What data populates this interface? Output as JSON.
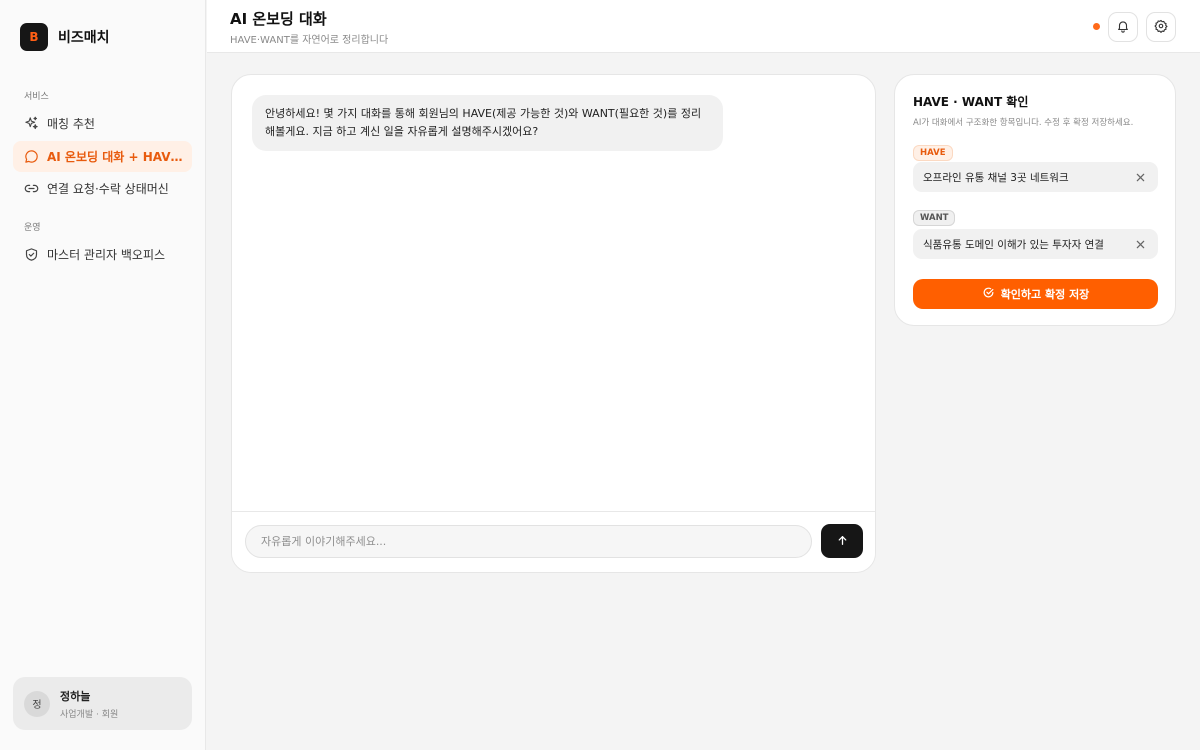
{
  "brand": {
    "logo_letter": "B",
    "name": "비즈매치"
  },
  "sidebar": {
    "sections": [
      {
        "label": "서비스"
      },
      {
        "label": "운영"
      }
    ],
    "items": [
      {
        "label": "매칭 추천",
        "icon": "sparkles-icon"
      },
      {
        "label": "AI 온보딩 대화 + HAVE·WANT 확인",
        "icon": "chat-bubble-icon",
        "active": true
      },
      {
        "label": "연결 요청·수락 상태머신",
        "icon": "link-icon"
      },
      {
        "label": "마스터 관리자 백오피스",
        "icon": "shield-check-icon"
      }
    ]
  },
  "user": {
    "avatar": "정",
    "name": "정하늘",
    "role": "사업개발 · 회원"
  },
  "header": {
    "title": "AI 온보딩 대화",
    "subtitle": "HAVE·WANT를 자연어로 정리합니다",
    "status_color": "#ff6a1a",
    "icons": [
      "bell-icon",
      "gear-icon"
    ]
  },
  "chat": {
    "messages": [
      {
        "role": "assistant",
        "text": "안녕하세요! 몇 가지 대화를 통해 회원님의 HAVE(제공 가능한 것)와 WANT(필요한 것)를 정리해볼게요. 지금 하고 계신 일을 자유롭게 설명해주시겠어요?"
      }
    ],
    "input_placeholder": "자유롭게 이야기해주세요...",
    "input_value": ""
  },
  "confirm": {
    "title": "HAVE · WANT 확인",
    "description": "AI가 대화에서 구조화한 항목입니다. 수정 후 확정 저장하세요.",
    "have_tag": "HAVE",
    "have_value": "오프라인 유통 채널 3곳 네트워크",
    "want_tag": "WANT",
    "want_value": "식품유통 도메인 이해가 있는 투자자 연결",
    "submit_label": "확인하고 확정 저장"
  },
  "colors": {
    "accent": "#ff5f00",
    "accent_soft": "#fff0e6",
    "dark": "#161616"
  }
}
